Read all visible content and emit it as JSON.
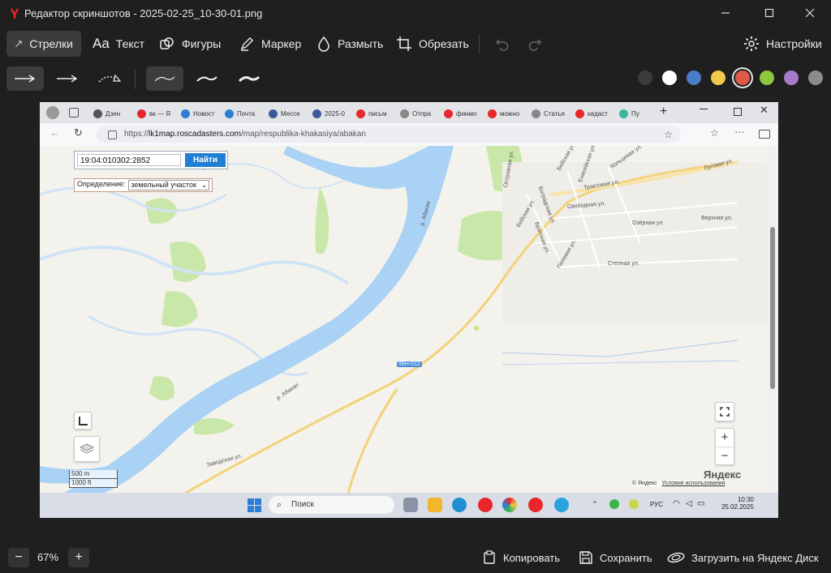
{
  "window": {
    "title": "Редактор скриншотов - 2025-02-25_10-30-01.png",
    "brand_color": "#e8262c"
  },
  "toolbar": {
    "arrows": "Стрелки",
    "text": "Текст",
    "text_icon_glyph": "Aa",
    "shapes": "Фигуры",
    "marker": "Маркер",
    "blur": "Размыть",
    "crop": "Обрезать",
    "settings": "Настройки"
  },
  "colors": [
    {
      "name": "dark-gray",
      "hex": "#3c3c3c"
    },
    {
      "name": "white",
      "hex": "#ffffff"
    },
    {
      "name": "blue",
      "hex": "#4a7cc7"
    },
    {
      "name": "yellow",
      "hex": "#f2c94c"
    },
    {
      "name": "red",
      "hex": "#e05a4a",
      "selected": true
    },
    {
      "name": "green",
      "hex": "#8dc63f"
    },
    {
      "name": "purple",
      "hex": "#a77bc9"
    },
    {
      "name": "gray",
      "hex": "#8c8c8c"
    }
  ],
  "screenshot": {
    "tabs": [
      "Дзен",
      "вк — Я",
      "Новост",
      "Почта",
      "Мессе",
      "2025-0",
      "письм",
      "Отпра",
      "финмо",
      "можно",
      "Статья",
      "кадаст",
      "Пу"
    ],
    "url_host": "lk1map.roscadasters.com",
    "url_path": "/map/respublika-khakasiya/abakan",
    "url_prefix": "https://",
    "map": {
      "cadastral_number": "19:04:010302:2852",
      "find_button": "Найти",
      "definition_label": "Определение:",
      "definition_value": "земельный участок",
      "scale_m": "500 m",
      "scale_ft": "1000 ft",
      "copyright": "© Яндекс",
      "terms": "Условия использования",
      "yandex_logo": "Яндекс",
      "zoom_in": "+",
      "zoom_out": "−",
      "labels": {
        "river1": "р. Абакан",
        "river2": "р. Абакан",
        "road_code": "95Н-012",
        "beyskaya": "Бейская ул.",
        "beyskaya2": "Бейская ул.",
        "traktovaya": "Трактовая ул.",
        "svobodnaya": "Свободная ул.",
        "ozernaya": "Озёрная ул.",
        "verkhnyaya": "Верхняя ул.",
        "stepnaya": "Степная ул.",
        "polevaya": "Полевая ул.",
        "bogradskaya": "Боградская ул.",
        "bratskaya": "Братская ул.",
        "lugovaya": "Луговая ул.",
        "kolcevaya": "Кольцевая ул.",
        "zavodskaya": "Заводская ул.",
        "ostrovnaya": "Островная ул.",
        "eniseyskaya": "Енисейская ул."
      }
    },
    "taskbar": {
      "search": "Поиск",
      "lang": "РУС",
      "time": "10:30",
      "date": "25.02.2025"
    }
  },
  "bottom": {
    "zoom": "67%",
    "zoom_out": "−",
    "zoom_in": "+",
    "copy": "Копировать",
    "save": "Сохранить",
    "upload": "Загрузить на Яндекс Диск"
  }
}
